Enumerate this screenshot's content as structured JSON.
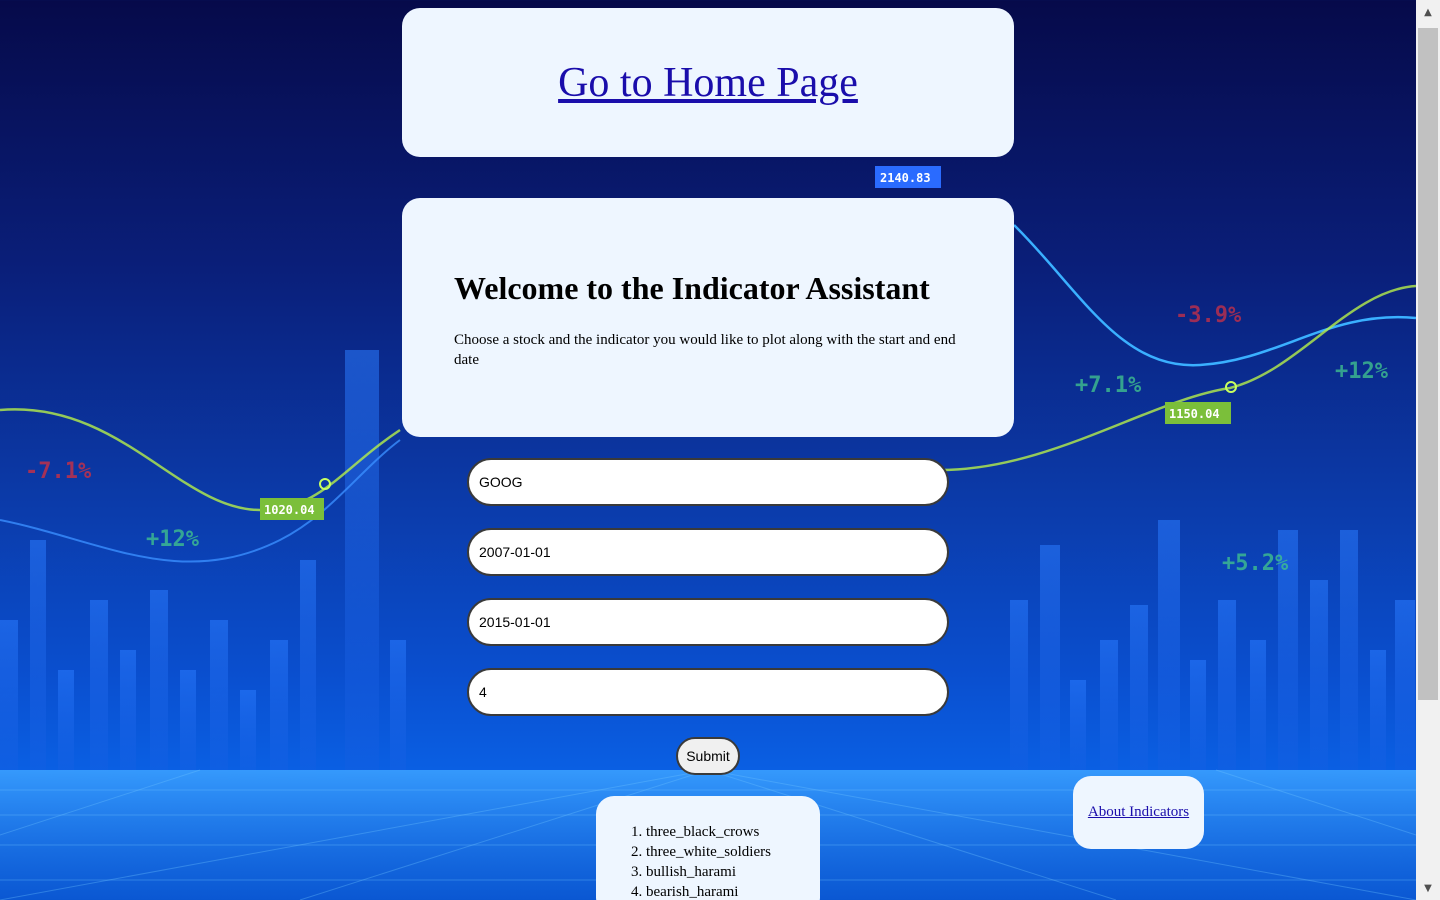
{
  "nav": {
    "home_link": "Go to Home Page"
  },
  "welcome": {
    "title": "Welcome to the Indicator Assistant",
    "description": "Choose a stock and the indicator you would like to plot along with the start and end date"
  },
  "form": {
    "stock_value": "GOOG",
    "start_date_value": "2007-01-01",
    "end_date_value": "2015-01-01",
    "indicator_value": "4",
    "submit_label": "Submit"
  },
  "indicators": [
    "three_black_crows",
    "three_white_soldiers",
    "bullish_harami",
    "bearish_harami"
  ],
  "about_link": "About Indicators",
  "background": {
    "tags": [
      "2140.83",
      "1020.04",
      "1150.04"
    ],
    "percents": [
      "-7.1%",
      "+12%",
      "-3.9%",
      "+7.1%",
      "+12%",
      "+5.2%"
    ]
  },
  "colors": {
    "card": "#eef6ff",
    "link": "#1a0dab",
    "bg_dark": "#060a4a",
    "bg_light": "#0a63e8"
  }
}
